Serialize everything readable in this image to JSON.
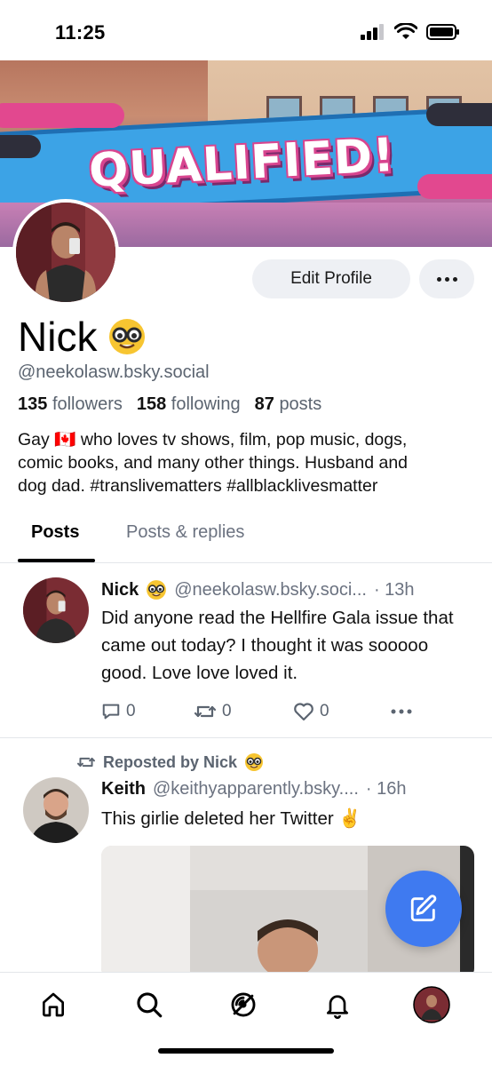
{
  "status_bar": {
    "time": "11:25"
  },
  "banner": {
    "text": "QUALIFIED!"
  },
  "profile": {
    "display_name": "Nick",
    "handle": "@neekolasw.bsky.social",
    "followers_count": "135",
    "followers_label": "followers",
    "following_count": "158",
    "following_label": "following",
    "posts_count": "87",
    "posts_label": "posts",
    "bio_line1": "Gay 🇨🇦 who loves tv shows, film, pop music, dogs,",
    "bio_line2": "comic books, and many other things. Husband and",
    "bio_line3": "dog dad. #translivematters #allblacklivesmatter",
    "edit_button": "Edit Profile"
  },
  "tabs": [
    {
      "label": "Posts",
      "active": true
    },
    {
      "label": "Posts & replies",
      "active": false
    }
  ],
  "posts": [
    {
      "author": "Nick",
      "handle": "@neekolasw.bsky.soci...",
      "time": "· 13h",
      "text": "Did anyone read the Hellfire Gala issue that came out today? I thought it was sooooo good. Love love loved it.",
      "replies": "0",
      "reposts": "0",
      "likes": "0"
    },
    {
      "repost_label": "Reposted by Nick",
      "author": "Keith",
      "handle": "@keithyapparently.bsky....",
      "time": "· 16h",
      "text": "This girlie deleted her Twitter ✌️"
    }
  ],
  "icons": {
    "status": [
      "signal-icon",
      "wifi-icon",
      "battery-icon"
    ],
    "nav": [
      "home-icon",
      "search-icon",
      "feeds-icon",
      "notifications-icon",
      "profile-avatar"
    ],
    "fab": "compose-icon"
  },
  "colors": {
    "accent": "#3f7af0",
    "muted": "#5b6470"
  }
}
